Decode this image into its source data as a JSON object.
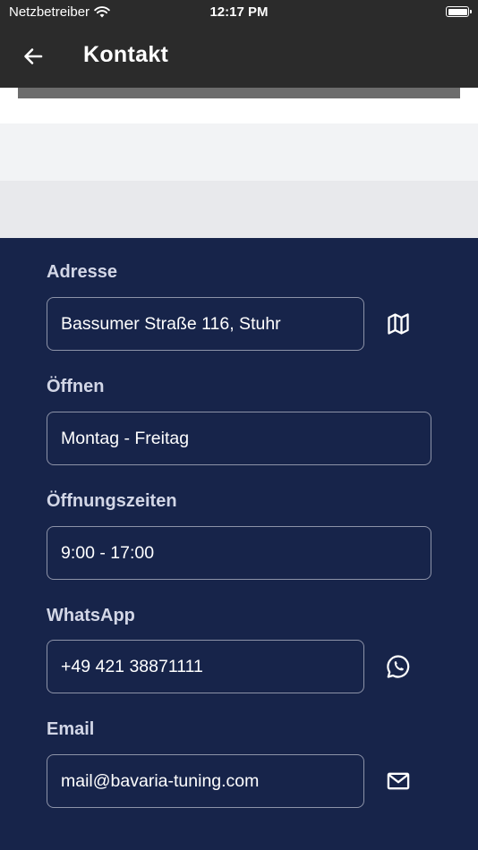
{
  "status_bar": {
    "carrier": "Netzbetreiber",
    "time": "12:17 PM",
    "wifi_icon": "wifi-icon",
    "battery_icon": "battery-icon",
    "battery_level": 1.0
  },
  "app_bar": {
    "back_icon": "arrow-left-icon",
    "title": "Kontakt"
  },
  "contact": {
    "address": {
      "label": "Adresse",
      "value": "Bassumer Straße 116, Stuhr",
      "action_icon": "map-icon"
    },
    "open_days": {
      "label": "Öffnen",
      "value": "Montag - Freitag"
    },
    "opening_hours": {
      "label": "Öffnungszeiten",
      "value": "9:00 - 17:00"
    },
    "whatsapp": {
      "label": "WhatsApp",
      "value": "+49 421 38871111",
      "action_icon": "whatsapp-icon"
    },
    "email": {
      "label": "Email",
      "value": "mail@bavaria-tuning.com",
      "action_icon": "mail-icon"
    }
  },
  "colors": {
    "app_bar_bg": "#2b2b2b",
    "panel_bg": "#17244a",
    "label_text": "#d2d6e6",
    "field_border": "#8d93a8",
    "field_text": "#ffffff"
  }
}
